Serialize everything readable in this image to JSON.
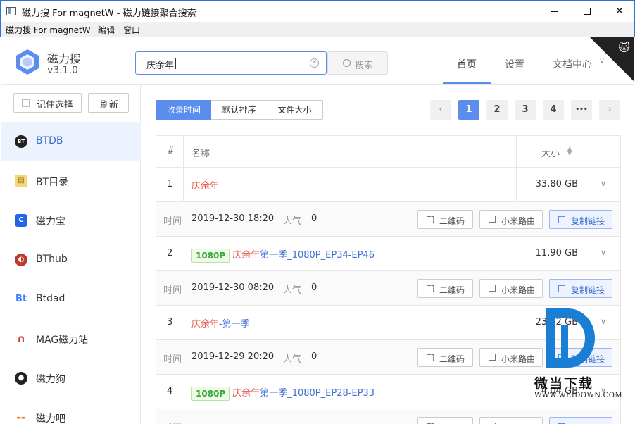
{
  "window": {
    "title": "磁力搜 For magnetW - 磁力链接聚合搜索"
  },
  "menu": [
    "磁力搜 For magnetW",
    "编辑",
    "窗口"
  ],
  "header": {
    "app_name": "磁力搜",
    "version": "v3.1.0",
    "search_value": "庆余年",
    "search_button": "搜索",
    "nav": {
      "home": "首页",
      "settings": "设置",
      "docs": "文档中心"
    }
  },
  "sidebar": {
    "remember_label": "记住选择",
    "refresh_label": "刷新",
    "sites": [
      {
        "label": "BTDB",
        "icon": "btdb-icon"
      },
      {
        "label": "BT目录",
        "icon": "bt-directory-icon"
      },
      {
        "label": "磁力宝",
        "icon": "cilibao-icon"
      },
      {
        "label": "BThub",
        "icon": "bthub-icon"
      },
      {
        "label": "Btdad",
        "icon": "btdad-icon"
      },
      {
        "label": "MAG磁力站",
        "icon": "magnet-icon"
      },
      {
        "label": "磁力狗",
        "icon": "dog-icon"
      },
      {
        "label": "磁力吧",
        "icon": "ciliba-icon"
      }
    ]
  },
  "sort": {
    "time": "收录时间",
    "default": "默认排序",
    "size": "文件大小"
  },
  "pagination": {
    "pages": [
      "1",
      "2",
      "3",
      "4"
    ],
    "more": "•••"
  },
  "table": {
    "headers": {
      "index": "#",
      "name": "名称",
      "size": "大小"
    },
    "meta_labels": {
      "time": "时间",
      "popularity": "人气",
      "qr": "二维码",
      "router": "小米路由",
      "copy": "复制链接"
    },
    "rows": [
      {
        "index": "1",
        "tag": "",
        "hl": "庆余年",
        "rest": "",
        "size": "33.80 GB",
        "time": "2019-12-30 18:20",
        "pop": "0"
      },
      {
        "index": "2",
        "tag": "1080P",
        "hl": "庆余年",
        "rest": "第一季_1080P_EP34-EP46",
        "size": "11.90 GB",
        "time": "2019-12-30 08:20",
        "pop": "0"
      },
      {
        "index": "3",
        "tag": "",
        "hl": "庆余年",
        "rest": "-第一季",
        "size": "23.72 GB",
        "time": "2019-12-29 20:20",
        "pop": "0"
      },
      {
        "index": "4",
        "tag": "1080P",
        "hl": "庆余年",
        "rest": "第一季_1080P_EP28-EP33",
        "size": "4.04 GB",
        "time": "",
        "pop": ""
      }
    ]
  },
  "watermark": {
    "text": "微当下载",
    "url": "WWW.WEIDOWN.COM"
  },
  "colors": {
    "accent": "#5b8def",
    "highlight": "#e8574d",
    "link": "#3e6fd0",
    "tag_green": "#3aa53a"
  }
}
